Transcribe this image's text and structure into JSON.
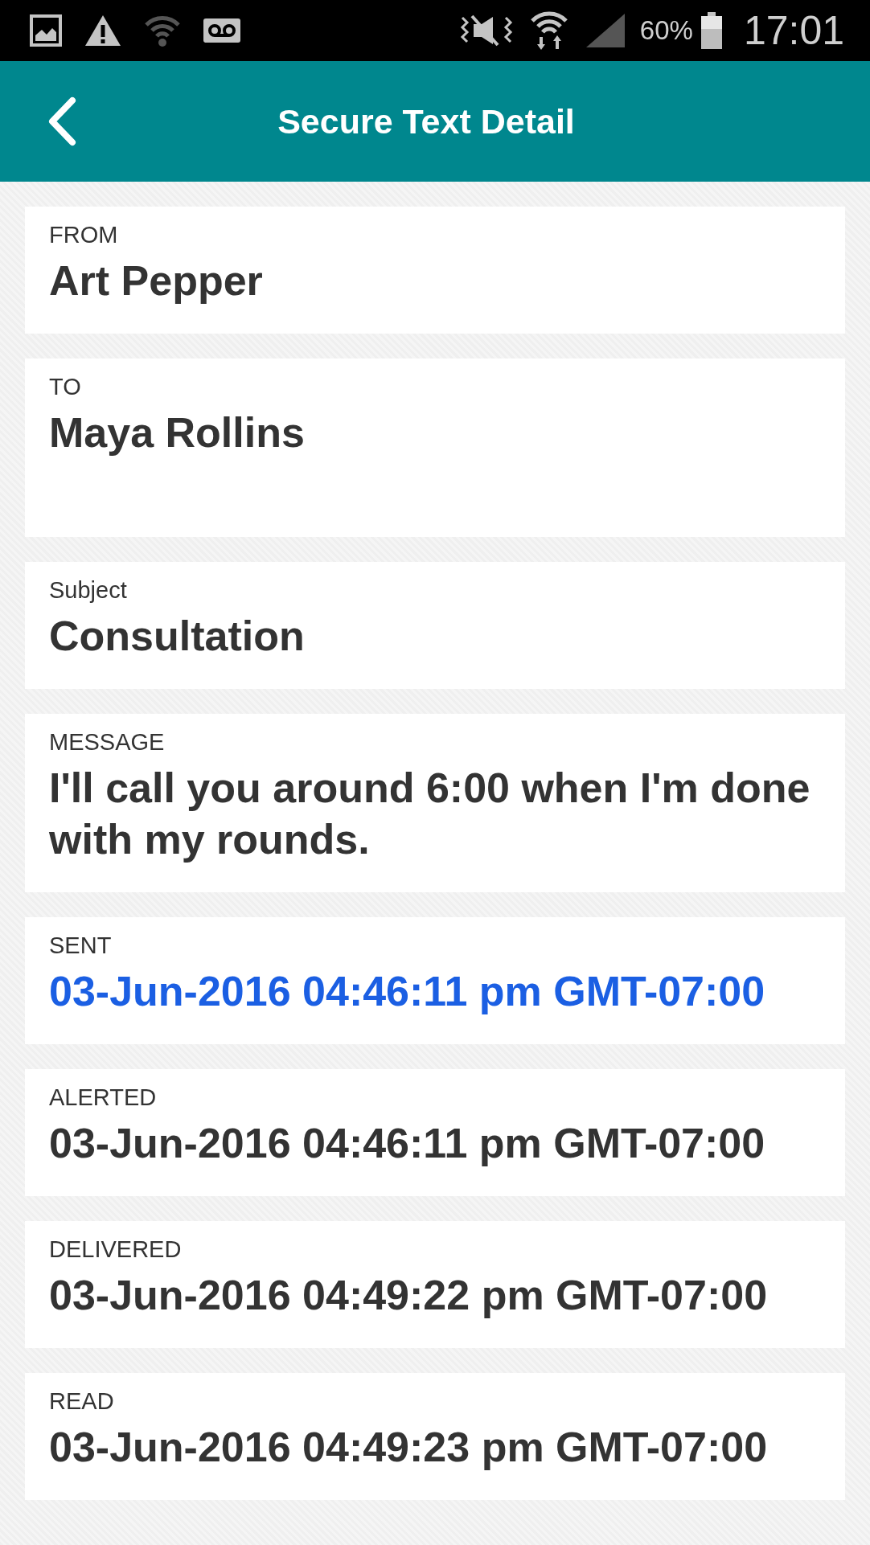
{
  "status_bar": {
    "battery": "60%",
    "time": "17:01"
  },
  "header": {
    "title": "Secure Text Detail"
  },
  "fields": [
    {
      "label": "FROM",
      "value": "Art Pepper",
      "kind": "line",
      "highlighted": false
    },
    {
      "label": "TO",
      "value": "Maya Rollins",
      "kind": "block",
      "highlighted": false
    },
    {
      "label": "Subject",
      "value": "Consultation",
      "kind": "line",
      "highlighted": false
    },
    {
      "label": "MESSAGE",
      "value": "I'll call you around 6:00 when I'm done with my rounds.",
      "kind": "block",
      "highlighted": false
    },
    {
      "label": "SENT",
      "value": "03-Jun-2016 04:46:11 pm GMT-07:00",
      "kind": "line",
      "highlighted": true
    },
    {
      "label": "ALERTED",
      "value": "03-Jun-2016 04:46:11 pm GMT-07:00",
      "kind": "line",
      "highlighted": false
    },
    {
      "label": "DELIVERED",
      "value": "03-Jun-2016 04:49:22 pm GMT-07:00",
      "kind": "line",
      "highlighted": false
    },
    {
      "label": "READ",
      "value": "03-Jun-2016 04:49:23 pm GMT-07:00",
      "kind": "line",
      "highlighted": false
    }
  ]
}
